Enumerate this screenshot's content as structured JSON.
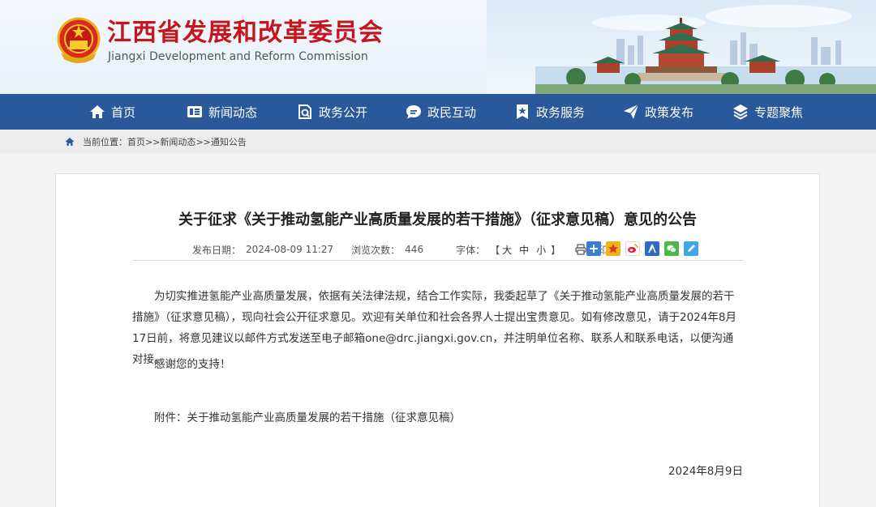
{
  "header": {
    "title_cn": "江西省发展和改革委员会",
    "title_en": "Jiangxi Development and Reform Commission",
    "emblem_icon": "national-emblem-icon",
    "brand_color": "#c4161c"
  },
  "nav": {
    "color": "#29599a",
    "items": [
      {
        "label": "首页",
        "icon": "home-icon"
      },
      {
        "label": "新闻动态",
        "icon": "news-icon"
      },
      {
        "label": "政务公开",
        "icon": "document-search-icon"
      },
      {
        "label": "政民互动",
        "icon": "chat-bubble-icon"
      },
      {
        "label": "政务服务",
        "icon": "bookmark-star-icon"
      },
      {
        "label": "政策发布",
        "icon": "paper-plane-icon"
      },
      {
        "label": "专题聚焦",
        "icon": "layers-icon"
      }
    ]
  },
  "breadcrumb": {
    "prefix": "当前位置：",
    "items": [
      "首页",
      "新闻动态",
      "通知公告"
    ],
    "sep": ">>"
  },
  "article": {
    "title": "关于征求《关于推动氢能产业高质量发展的若干措施》（征求意见稿）意见的公告",
    "meta": {
      "date_label": "发布日期：",
      "date": "2024-08-09 11:27",
      "views_label": "浏览次数：",
      "views": "446",
      "font_label": "字体：",
      "font_open": "【",
      "font_sizes": [
        "大",
        "中",
        "小"
      ],
      "font_close": "】",
      "print_label": "打印"
    },
    "share_icons": [
      "plus-share-icon",
      "star-share-icon",
      "weibo-icon",
      "renren-icon",
      "wechat-icon",
      "pen-share-icon"
    ],
    "paragraph": "为切实推进氢能产业高质量发展，依据有关法律法规，结合工作实际，我委起草了《关于推动氢能产业高质量发展的若干措施》（征求意见稿），现向社会公开征求意见。欢迎有关单位和社会各界人士提出宝贵意见。如有修改意见，请于2024年8月17日前，将意见建议以邮件方式发送至电子邮箱one@drc.jiangxi.gov.cn，并注明单位名称、联系人和联系电话，以便沟通对接。",
    "thanks": "感谢您的支持！",
    "attachment_label": "附件：",
    "attachment_link": "关于推动氢能产业高质量发展的若干措施（征求意见稿）",
    "sign_date": "2024年8月9日"
  }
}
